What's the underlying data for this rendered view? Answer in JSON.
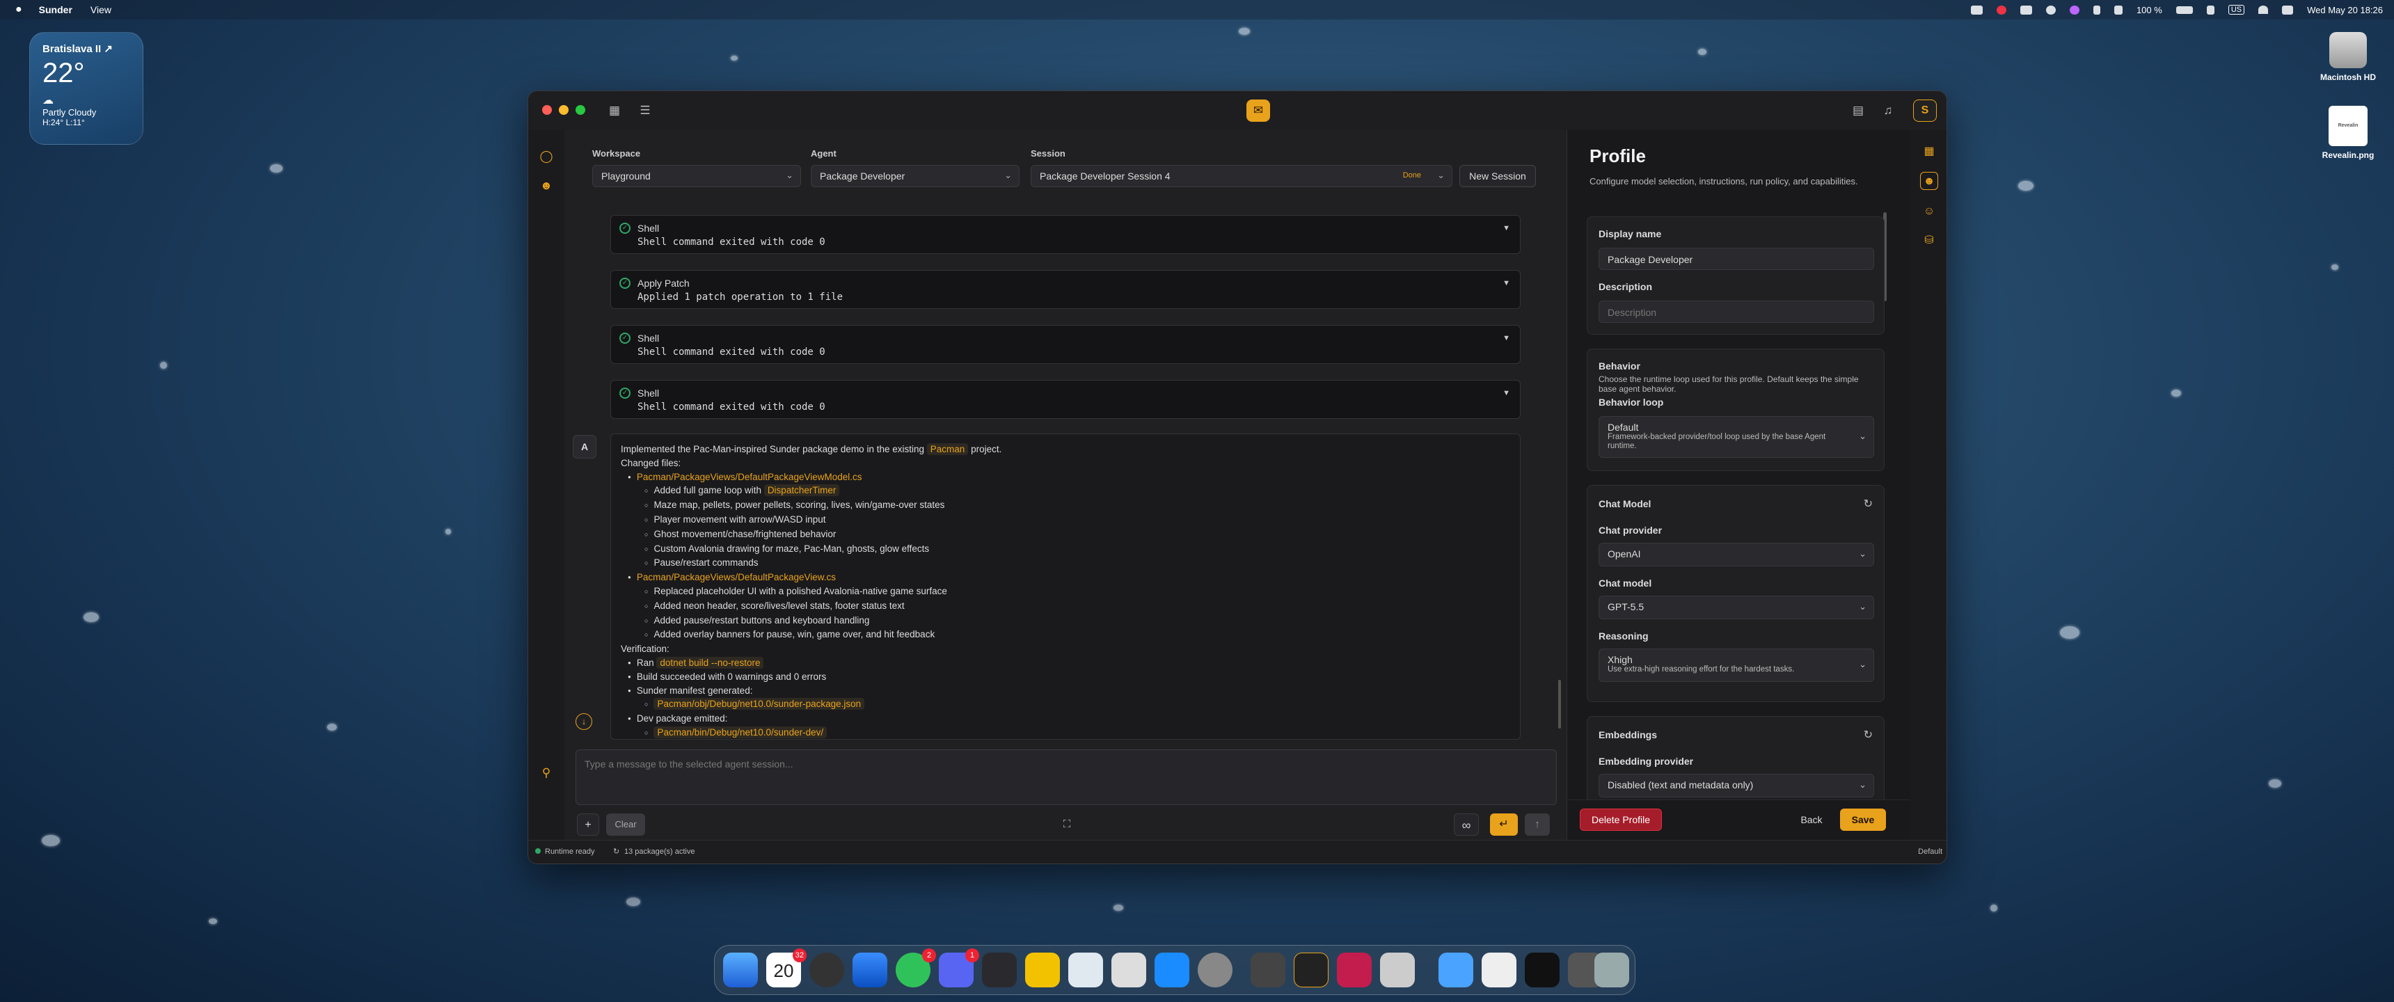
{
  "menubar": {
    "apple": "",
    "app_name": "Sunder",
    "menu_view": "View",
    "battery": "100 %",
    "datetime": "Wed May 20  18:26",
    "input_badge": "US"
  },
  "widget": {
    "city": "Bratislava II ↗",
    "temp": "22°",
    "condition": "Partly Cloudy",
    "hilo": "H:24° L:11°"
  },
  "desktop": {
    "disk_label": "Macintosh HD",
    "file_label": "Revealin.png",
    "file_thumb_text": "Revealin"
  },
  "header": {
    "workspace_label": "Workspace",
    "workspace_value": "Playground",
    "agent_label": "Agent",
    "agent_value": "Package Developer",
    "session_label": "Session",
    "session_value": "Package Developer Session 4",
    "session_status": "Done",
    "new_session": "New Session"
  },
  "tools": [
    {
      "name": "Shell",
      "result": "Shell command exited with code 0"
    },
    {
      "name": "Apply Patch",
      "result": "Applied 1 patch operation to 1 file"
    },
    {
      "name": "Shell",
      "result": "Shell command exited with code 0"
    },
    {
      "name": "Shell",
      "result": "Shell command exited with code 0"
    }
  ],
  "message": {
    "avatar": "A",
    "intro_a": "Implemented the Pac-Man-inspired Sunder package demo in the existing",
    "intro_code": "Pacman",
    "intro_b": "project.",
    "changed_files": "Changed files:",
    "file1": "Pacman/PackageViews/DefaultPackageViewModel.cs",
    "f1_a_pre": "Added full game loop with",
    "f1_a_code": "DispatcherTimer",
    "f1_items": [
      "Maze map, pellets, power pellets, scoring, lives, win/game-over states",
      "Player movement with arrow/WASD input",
      "Ghost movement/chase/frightened behavior",
      "Custom Avalonia drawing for maze, Pac-Man, ghosts, glow effects",
      "Pause/restart commands"
    ],
    "file2": "Pacman/PackageViews/DefaultPackageView.cs",
    "f2_items": [
      "Replaced placeholder UI with a polished Avalonia-native game surface",
      "Added neon header, score/lives/level stats, footer status text",
      "Added pause/restart buttons and keyboard handling",
      "Added overlay banners for pause, win, game over, and hit feedback"
    ],
    "verification": "Verification:",
    "ran_pre": "Ran",
    "ran_code": "dotnet build --no-restore",
    "build_ok": "Build succeeded with 0 warnings and 0 errors",
    "manifest": "Sunder manifest generated:",
    "manifest_path": "Pacman/obj/Debug/net10.0/sunder-package.json",
    "devpkg": "Dev package emitted:",
    "devpkg_path": "Pacman/bin/Debug/net10.0/sunder-dev/"
  },
  "composer": {
    "placeholder": "Type a message to the selected agent session...",
    "plus": "+",
    "clear": "Clear"
  },
  "profile": {
    "title": "Profile",
    "subtitle": "Configure model selection, instructions, run policy, and capabilities.",
    "display_name_label": "Display name",
    "display_name_value": "Package Developer",
    "description_label": "Description",
    "description_placeholder": "Description",
    "behavior_title": "Behavior",
    "behavior_desc": "Choose the runtime loop used for this profile. Default keeps the simple base agent behavior.",
    "behavior_loop_label": "Behavior loop",
    "behavior_loop_value": "Default",
    "behavior_loop_desc": "Framework-backed provider/tool loop used by the base Agent runtime.",
    "chat_model_title": "Chat Model",
    "chat_provider_label": "Chat provider",
    "chat_provider_value": "OpenAI",
    "chat_model_label": "Chat model",
    "chat_model_value": "GPT-5.5",
    "reasoning_label": "Reasoning",
    "reasoning_value": "Xhigh",
    "reasoning_desc": "Use extra-high reasoning effort for the hardest tasks.",
    "embeddings_title": "Embeddings",
    "embedding_provider_label": "Embedding provider",
    "embedding_provider_value": "Disabled (text and metadata only)",
    "delete": "Delete Profile",
    "back": "Back",
    "save": "Save"
  },
  "status": {
    "runtime": "Runtime ready",
    "packages": "13 package(s) active",
    "right": "Default"
  },
  "dock": {
    "calendar_day": "20",
    "badge_calendar": "32",
    "badge_messages": "2",
    "badge_discord": "1"
  },
  "colors": {
    "accent": "#e9a21b",
    "success": "#2fa866",
    "danger": "#d9303e"
  }
}
